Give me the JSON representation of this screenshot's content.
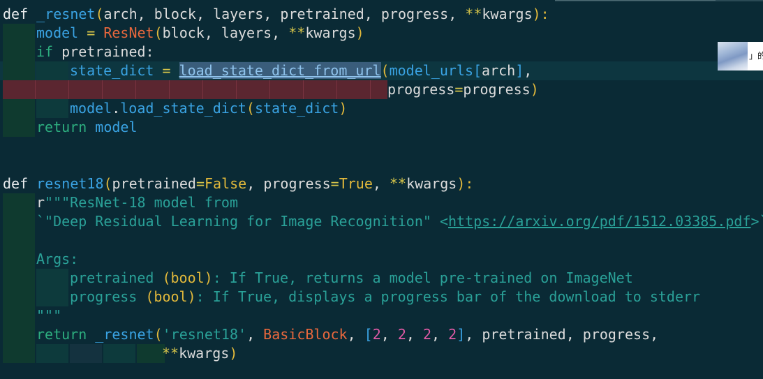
{
  "editor": {
    "language": "python",
    "lines": {
      "l1": {
        "kw": "def",
        "fn": "_resnet",
        "args": "arch, block, layers, pretrained, progress, ",
        "star": "**",
        "kwargs": "kwargs"
      },
      "l2": {
        "var": "model",
        "eq": " = ",
        "cls": "ResNet",
        "args": "block, layers, ",
        "star": "**",
        "kwargs": "kwargs"
      },
      "l3": {
        "kw": "if",
        "rest": " pretrained:"
      },
      "l4": {
        "var": "state_dict",
        "eq": " = ",
        "sel": "load_state_dict_from_url",
        "arg1": "model_urls",
        "arg2": "arch",
        "tail": ","
      },
      "l5": {
        "name": "progress",
        "eq": "=",
        "val": "progress"
      },
      "l6": {
        "obj": "model",
        "dot": ".",
        "method": "load_state_dict",
        "arg": "state_dict"
      },
      "l7": {
        "kw": "return",
        "val": " model"
      },
      "l8": {
        "kw": "def",
        "fn": "resnet18",
        "p1": "pretrained",
        "false": "False",
        "p2": "progress",
        "true": "True",
        "star": "**",
        "kwargs": "kwargs"
      },
      "l9": {
        "prefix": "r",
        "text": "\"\"\"ResNet-18 model from"
      },
      "l10": {
        "pre": "`\"Deep Residual Learning for Image Recognition\" <",
        "url": "https://arxiv.org/pdf/1512.03385.pdf",
        "post": ">`"
      },
      "l11": {
        "text": "Args:"
      },
      "l12": {
        "text1": "pretrained ",
        "paren": "(bool)",
        "text2": ": If True, returns a model pre-trained on ImageNet"
      },
      "l13": {
        "text1": "progress ",
        "paren": "(bool)",
        "text2": ": If True, displays a progress bar of the download to stderr"
      },
      "l14": {
        "text": "\"\"\""
      },
      "l15": {
        "kw": "return",
        "fn": "_resnet",
        "str": "'resnet18'",
        "cls": "BasicBlock",
        "n1": "2",
        "n2": "2",
        "n3": "2",
        "n4": "2",
        "rest": ", pretrained, progress,"
      },
      "l16": {
        "star": "**",
        "kwargs": "kwargs"
      }
    }
  },
  "tooltip": {
    "text": "」的"
  },
  "colors": {
    "background": "#0a2a35",
    "error_band": "#5b2630",
    "selection": "#3a5d7b"
  }
}
